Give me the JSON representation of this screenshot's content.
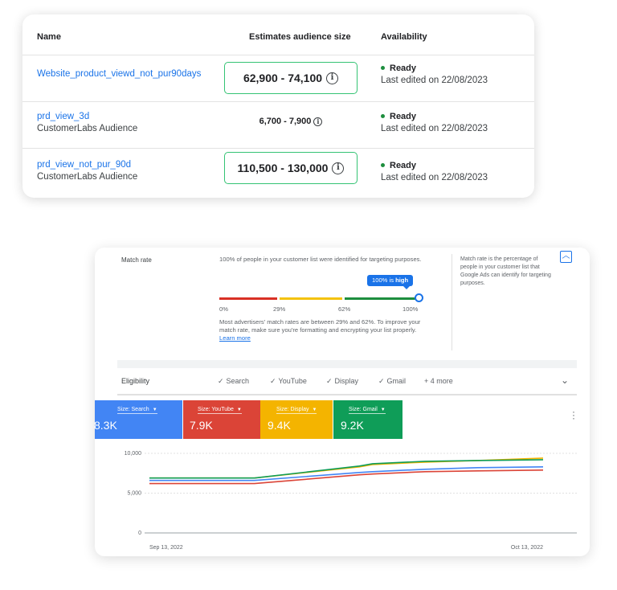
{
  "audiences": {
    "headers": {
      "name": "Name",
      "size": "Estimates audience size",
      "availability": "Availability"
    },
    "rows": [
      {
        "name": "Website_product_viewd_not_pur90days",
        "sub": "",
        "size": "62,900 - 74,100",
        "highlighted": true,
        "status": "Ready",
        "edited": "Last edited on 22/08/2023"
      },
      {
        "name": "prd_view_3d",
        "sub": "CustomerLabs Audience",
        "size": "6,700 - 7,900",
        "highlighted": false,
        "status": "Ready",
        "edited": "Last edited on 22/08/2023"
      },
      {
        "name": "prd_view_not_pur_90d",
        "sub": "CustomerLabs Audience",
        "size": "110,500 - 130,000",
        "highlighted": true,
        "status": "Ready",
        "edited": "Last edited on 22/08/2023"
      }
    ],
    "info_icon": "info-icon",
    "colors": {
      "link": "#1a73e8",
      "highlight_border": "#34c374",
      "status_dot": "#1e8e3e"
    }
  },
  "match_rate": {
    "label": "Match rate",
    "description": "100% of people in your customer list were identified for targeting purposes.",
    "badge_percent": "100%",
    "badge_is": "is",
    "badge_level": "high",
    "value_percent": 100,
    "ticks": [
      "0%",
      "29%",
      "62%",
      "100%"
    ],
    "note": "Most advertisers' match rates are between 29% and 62%. To improve your match rate, make sure you're formatting and encrypting your list properly.",
    "learn_more": "Learn more",
    "side_note": "Match rate is the percentage of people in your customer list that Google Ads can identify for targeting purposes.",
    "colors": {
      "low": "#d93025",
      "mid": "#f4c20d",
      "high": "#1e8e3e",
      "accent": "#1a73e8"
    }
  },
  "eligibility": {
    "title": "Eligibility",
    "items": [
      "Search",
      "YouTube",
      "Display",
      "Gmail"
    ],
    "more": "+ 4 more"
  },
  "metrics": [
    {
      "label": "Size: Search",
      "value": "8.3K",
      "color": "#4285f4"
    },
    {
      "label": "Size: YouTube",
      "value": "7.9K",
      "color": "#db4437"
    },
    {
      "label": "Size: Display",
      "value": "9.4K",
      "color": "#f4b400"
    },
    {
      "label": "Size: Gmail",
      "value": "9.2K",
      "color": "#0f9d58"
    }
  ],
  "chart_data": {
    "type": "line",
    "x": [
      "Sep 13, 2022",
      "Sep 21, 2022",
      "Sep 29, 2022",
      "Sep 30, 2022",
      "Oct 04, 2022",
      "Oct 08, 2022",
      "Oct 13, 2022"
    ],
    "x_tick_labels": [
      "Sep 13, 2022",
      "Oct 13, 2022"
    ],
    "y_ticks": [
      "0",
      "5,000",
      "10,000"
    ],
    "ylim": [
      0,
      10000
    ],
    "series": [
      {
        "color": "#4285f4",
        "values": [
          6600,
          6600,
          7600,
          7700,
          8000,
          8200,
          8300
        ]
      },
      {
        "color": "#db4437",
        "values": [
          6200,
          6200,
          7300,
          7400,
          7700,
          7800,
          7900
        ]
      },
      {
        "color": "#f4b400",
        "values": [
          6900,
          6900,
          8300,
          8600,
          8900,
          9100,
          9400
        ]
      },
      {
        "color": "#0f9d58",
        "values": [
          6900,
          6900,
          8400,
          8700,
          9000,
          9100,
          9200
        ]
      }
    ]
  }
}
